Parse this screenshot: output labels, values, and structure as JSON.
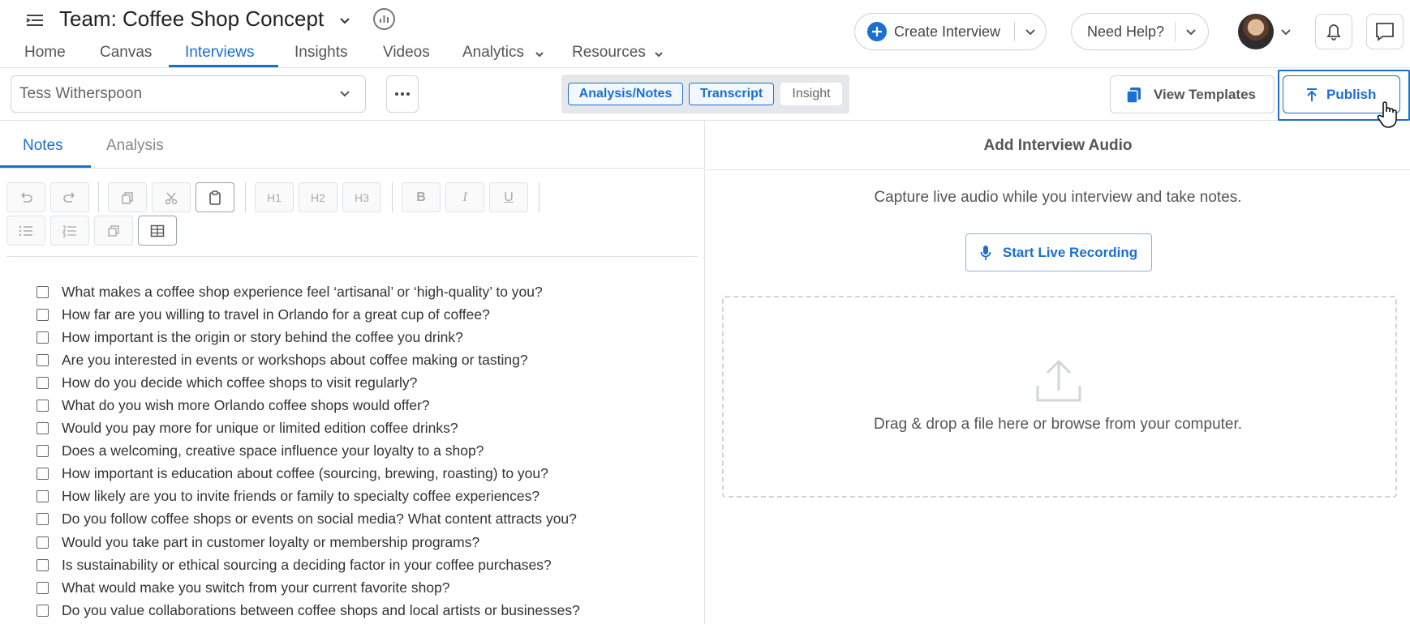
{
  "header": {
    "team_title": "Team: Coffee Shop Concept",
    "nav": [
      {
        "label": "Home"
      },
      {
        "label": "Canvas"
      },
      {
        "label": "Interviews"
      },
      {
        "label": "Insights"
      },
      {
        "label": "Videos"
      },
      {
        "label": "Analytics"
      },
      {
        "label": "Resources"
      }
    ],
    "create_interview_label": "Create Interview",
    "need_help_label": "Need Help?"
  },
  "toolbar2": {
    "interviewee": "Tess Witherspoon",
    "segments": [
      {
        "label": "Analysis/Notes"
      },
      {
        "label": "Transcript"
      },
      {
        "label": "Insight"
      }
    ],
    "view_templates_label": "View Templates",
    "publish_label": "Publish"
  },
  "left_panel": {
    "tabs": [
      {
        "label": "Notes"
      },
      {
        "label": "Analysis"
      }
    ],
    "editor_buttons": {
      "h1": "H1",
      "h2": "H2",
      "h3": "H3",
      "bold": "B",
      "italic": "I",
      "underline": "U"
    },
    "questions": [
      "What makes a coffee shop experience feel ‘artisanal’ or ‘high-quality’ to you?",
      "How far are you willing to travel in Orlando for a great cup of coffee?",
      "How important is the origin or story behind the coffee you drink?",
      "Are you interested in events or workshops about coffee making or tasting?",
      "How do you decide which coffee shops to visit regularly?",
      "What do you wish more Orlando coffee shops would offer?",
      "Would you pay more for unique or limited edition coffee drinks?",
      "Does a welcoming, creative space influence your loyalty to a shop?",
      "How important is education about coffee (sourcing, brewing, roasting) to you?",
      "How likely are you to invite friends or family to specialty coffee experiences?",
      "Do you follow coffee shops or events on social media? What content attracts you?",
      "Would you take part in customer loyalty or membership programs?",
      "Is sustainability or ethical sourcing a deciding factor in your coffee purchases?",
      "What would make you switch from your current favorite shop?",
      "Do you value collaborations between coffee shops and local artists or businesses?"
    ]
  },
  "right_panel": {
    "title": "Add Interview Audio",
    "subtitle": "Capture live audio while you interview and take notes.",
    "record_label": "Start Live Recording",
    "drop_text": "Drag & drop a file here or browse from your computer."
  },
  "colors": {
    "accent": "#1a6fd1",
    "border": "#cfd4da"
  }
}
